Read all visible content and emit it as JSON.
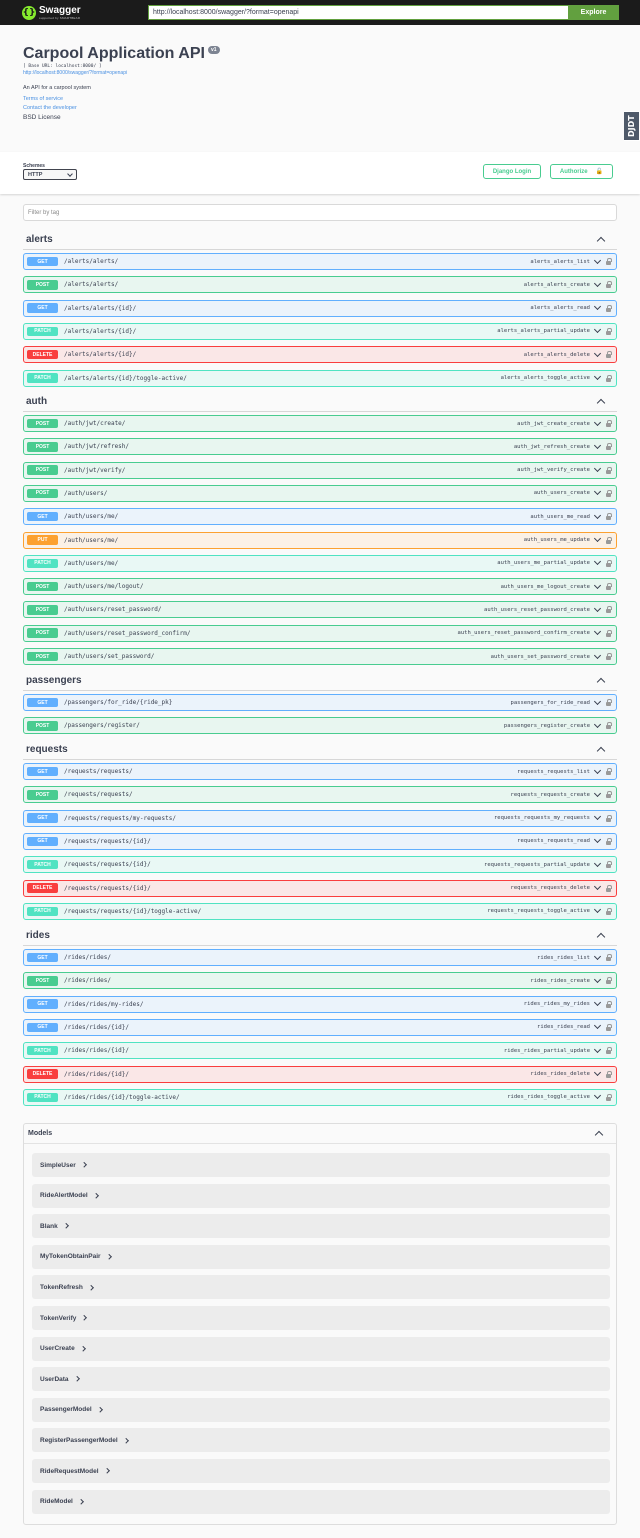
{
  "topbar": {
    "logo_title": "Swagger",
    "logo_sub": "supported by SMARTBEAR",
    "url_value": "http://localhost:8000/swagger/?format=openapi",
    "explore_label": "Explore"
  },
  "info": {
    "title": "Carpool Application API",
    "version": "v1",
    "base_url": "[ Base URL: localhost:8000/ ]",
    "spec_link": "http://localhost:8000/swagger/?format=openapi",
    "description": "An API for a carpool system",
    "terms": "Terms of service",
    "contact": "Contact the developer",
    "license": "BSD License"
  },
  "djdt_label": "DJDT",
  "schemes": {
    "label": "Schemes",
    "selected": "HTTP",
    "django_login": "Django Login",
    "authorize": "Authorize"
  },
  "filter_placeholder": "Filter by tag",
  "colors": {
    "get": "#61affe",
    "post": "#49cc90",
    "patch": "#50e3c2",
    "delete": "#f93e3e",
    "put": "#fca130"
  },
  "tags": [
    {
      "name": "alerts",
      "operations": [
        {
          "method": "GET",
          "path": "/alerts/alerts/",
          "id": "alerts_alerts_list"
        },
        {
          "method": "POST",
          "path": "/alerts/alerts/",
          "id": "alerts_alerts_create"
        },
        {
          "method": "GET",
          "path": "/alerts/alerts/{id}/",
          "id": "alerts_alerts_read"
        },
        {
          "method": "PATCH",
          "path": "/alerts/alerts/{id}/",
          "id": "alerts_alerts_partial_update"
        },
        {
          "method": "DELETE",
          "path": "/alerts/alerts/{id}/",
          "id": "alerts_alerts_delete"
        },
        {
          "method": "PATCH",
          "path": "/alerts/alerts/{id}/toggle-active/",
          "id": "alerts_alerts_toggle_active"
        }
      ]
    },
    {
      "name": "auth",
      "operations": [
        {
          "method": "POST",
          "path": "/auth/jwt/create/",
          "id": "auth_jwt_create_create"
        },
        {
          "method": "POST",
          "path": "/auth/jwt/refresh/",
          "id": "auth_jwt_refresh_create"
        },
        {
          "method": "POST",
          "path": "/auth/jwt/verify/",
          "id": "auth_jwt_verify_create"
        },
        {
          "method": "POST",
          "path": "/auth/users/",
          "id": "auth_users_create"
        },
        {
          "method": "GET",
          "path": "/auth/users/me/",
          "id": "auth_users_me_read"
        },
        {
          "method": "PUT",
          "path": "/auth/users/me/",
          "id": "auth_users_me_update"
        },
        {
          "method": "PATCH",
          "path": "/auth/users/me/",
          "id": "auth_users_me_partial_update"
        },
        {
          "method": "POST",
          "path": "/auth/users/me/logout/",
          "id": "auth_users_me_logout_create"
        },
        {
          "method": "POST",
          "path": "/auth/users/reset_password/",
          "id": "auth_users_reset_password_create"
        },
        {
          "method": "POST",
          "path": "/auth/users/reset_password_confirm/",
          "id": "auth_users_reset_password_confirm_create"
        },
        {
          "method": "POST",
          "path": "/auth/users/set_password/",
          "id": "auth_users_set_password_create"
        }
      ]
    },
    {
      "name": "passengers",
      "operations": [
        {
          "method": "GET",
          "path": "/passengers/for_ride/{ride_pk}",
          "id": "passengers_for_ride_read"
        },
        {
          "method": "POST",
          "path": "/passengers/register/",
          "id": "passengers_register_create"
        }
      ]
    },
    {
      "name": "requests",
      "operations": [
        {
          "method": "GET",
          "path": "/requests/requests/",
          "id": "requests_requests_list"
        },
        {
          "method": "POST",
          "path": "/requests/requests/",
          "id": "requests_requests_create"
        },
        {
          "method": "GET",
          "path": "/requests/requests/my-requests/",
          "id": "requests_requests_my_requests"
        },
        {
          "method": "GET",
          "path": "/requests/requests/{id}/",
          "id": "requests_requests_read"
        },
        {
          "method": "PATCH",
          "path": "/requests/requests/{id}/",
          "id": "requests_requests_partial_update"
        },
        {
          "method": "DELETE",
          "path": "/requests/requests/{id}/",
          "id": "requests_requests_delete"
        },
        {
          "method": "PATCH",
          "path": "/requests/requests/{id}/toggle-active/",
          "id": "requests_requests_toggle_active"
        }
      ]
    },
    {
      "name": "rides",
      "operations": [
        {
          "method": "GET",
          "path": "/rides/rides/",
          "id": "rides_rides_list"
        },
        {
          "method": "POST",
          "path": "/rides/rides/",
          "id": "rides_rides_create"
        },
        {
          "method": "GET",
          "path": "/rides/rides/my-rides/",
          "id": "rides_rides_my_rides"
        },
        {
          "method": "GET",
          "path": "/rides/rides/{id}/",
          "id": "rides_rides_read"
        },
        {
          "method": "PATCH",
          "path": "/rides/rides/{id}/",
          "id": "rides_rides_partial_update"
        },
        {
          "method": "DELETE",
          "path": "/rides/rides/{id}/",
          "id": "rides_rides_delete"
        },
        {
          "method": "PATCH",
          "path": "/rides/rides/{id}/toggle-active/",
          "id": "rides_rides_toggle_active"
        }
      ]
    }
  ],
  "models": {
    "title": "Models",
    "items": [
      "SimpleUser",
      "RideAlertModel",
      "Blank",
      "MyTokenObtainPair",
      "TokenRefresh",
      "TokenVerify",
      "UserCreate",
      "UserData",
      "PassengerModel",
      "RegisterPassengerModel",
      "RideRequestModel",
      "RideModel"
    ]
  }
}
